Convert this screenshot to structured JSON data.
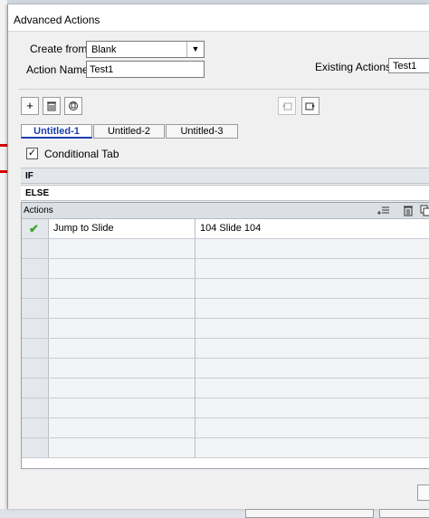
{
  "window": {
    "title": "Advanced Actions"
  },
  "form": {
    "create_from_label": "Create from:",
    "create_from_value": "Blank",
    "action_name_label": "Action Name:",
    "action_name_value": "Test1",
    "existing_label": "Existing Actions:",
    "existing_value": "Test1"
  },
  "tabs": [
    {
      "label": "Untitled-1",
      "active": true
    },
    {
      "label": "Untitled-2",
      "active": false
    },
    {
      "label": "Untitled-3",
      "active": false
    }
  ],
  "conditional": {
    "label": "Conditional Tab",
    "checked": true
  },
  "sections": {
    "if_label": "IF",
    "else_label": "ELSE"
  },
  "actions_grid": {
    "header": "Actions",
    "rows": [
      {
        "action": "Jump to Slide",
        "target": "104 Slide 104",
        "valid": true
      }
    ]
  }
}
